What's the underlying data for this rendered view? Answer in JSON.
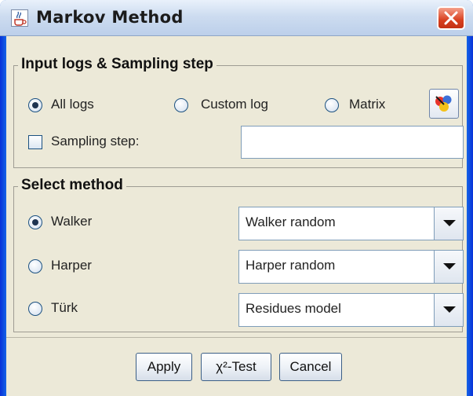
{
  "window": {
    "title": "Markov Method",
    "icon": "java-cup-icon",
    "close": "close-icon"
  },
  "input_group": {
    "legend": "Input logs & Sampling step",
    "radios": [
      {
        "label": "All logs",
        "checked": true
      },
      {
        "label": "Custom log",
        "checked": false
      },
      {
        "label": "Matrix",
        "checked": false
      }
    ],
    "sampling_label": "Sampling step:",
    "sampling_checked": false,
    "sampling_value": "",
    "chooser_icon": "color-chooser-icon"
  },
  "method_group": {
    "legend": "Select method",
    "rows": [
      {
        "label": "Walker",
        "checked": true,
        "selected": "Walker random"
      },
      {
        "label": "Harper",
        "checked": false,
        "selected": "Harper random"
      },
      {
        "label": "Türk",
        "checked": false,
        "selected": "Residues model"
      }
    ]
  },
  "buttons": {
    "apply": "Apply",
    "chi_test": "χ²-Test",
    "cancel": "Cancel"
  },
  "colors": {
    "title_bar": "#cddcf0",
    "frame": "#0b5fd3",
    "panel": "#ece9d8",
    "close_button": "#d8401f"
  }
}
